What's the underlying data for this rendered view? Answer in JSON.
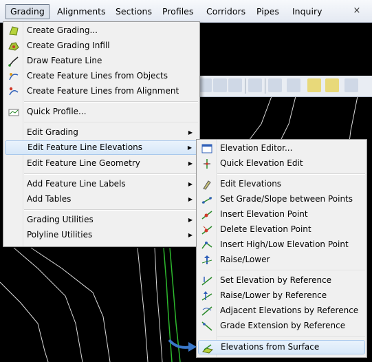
{
  "menubar": {
    "items": [
      {
        "label": "Grading"
      },
      {
        "label": "Alignments"
      },
      {
        "label": "Sections"
      },
      {
        "label": "Profiles"
      },
      {
        "label": "Corridors"
      },
      {
        "label": "Pipes"
      },
      {
        "label": "Inquiry"
      }
    ],
    "close_glyph": "×"
  },
  "grading_menu": {
    "items": [
      {
        "label": "Create Grading...",
        "icon": "create-grading-icon"
      },
      {
        "label": "Create Grading Infill",
        "icon": "grading-infill-icon"
      },
      {
        "label": "Draw Feature Line",
        "icon": "draw-feature-line-icon"
      },
      {
        "label": "Create Feature Lines from Objects",
        "icon": "feature-lines-from-objects-icon"
      },
      {
        "label": "Create Feature Lines from Alignment",
        "icon": "feature-lines-from-alignment-icon"
      },
      {
        "label": "Quick Profile...",
        "icon": "quick-profile-icon"
      },
      {
        "label": "Edit Grading"
      },
      {
        "label": "Edit Feature Line Elevations"
      },
      {
        "label": "Edit Feature Line Geometry"
      },
      {
        "label": "Add Feature Line Labels"
      },
      {
        "label": "Add Tables"
      },
      {
        "label": "Grading Utilities"
      },
      {
        "label": "Polyline Utilities"
      }
    ],
    "submenu_arrow": "▶"
  },
  "elevations_menu": {
    "items": [
      {
        "label": "Elevation Editor...",
        "icon": "elevation-editor-icon"
      },
      {
        "label": "Quick Elevation Edit",
        "icon": "quick-elevation-edit-icon"
      },
      {
        "label": "Edit Elevations",
        "icon": "edit-elevations-icon"
      },
      {
        "label": "Set Grade/Slope between Points",
        "icon": "set-grade-slope-icon"
      },
      {
        "label": "Insert Elevation Point",
        "icon": "insert-elevation-point-icon"
      },
      {
        "label": "Delete Elevation Point",
        "icon": "delete-elevation-point-icon"
      },
      {
        "label": "Insert High/Low Elevation Point",
        "icon": "insert-high-low-point-icon"
      },
      {
        "label": "Raise/Lower",
        "icon": "raise-lower-icon"
      },
      {
        "label": "Set Elevation by Reference",
        "icon": "set-elevation-by-reference-icon"
      },
      {
        "label": "Raise/Lower by Reference",
        "icon": "raise-lower-by-reference-icon"
      },
      {
        "label": "Adjacent Elevations by Reference",
        "icon": "adjacent-elevations-icon"
      },
      {
        "label": "Grade Extension by Reference",
        "icon": "grade-extension-icon"
      },
      {
        "label": "Elevations from Surface",
        "icon": "elevations-from-surface-icon"
      }
    ]
  },
  "colors": {
    "highlight": "#d6e7f8",
    "highlight_border": "#a8c8ec",
    "cad_background": "#000000",
    "pointer_arrow": "#3a78c9"
  }
}
